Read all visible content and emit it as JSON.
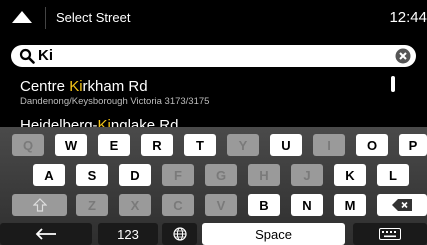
{
  "header": {
    "title": "Select Street",
    "time": "12:44"
  },
  "search": {
    "value": "Ki"
  },
  "results": [
    {
      "prefix": "Centre ",
      "match": "Ki",
      "suffix": "rkham Rd",
      "subtitle": "Dandenong/Keysborough Victoria 3173/3175"
    },
    {
      "prefix": "Heidelberg-",
      "match": "Ki",
      "suffix": "nglake Rd",
      "subtitle": ""
    }
  ],
  "keyboard": {
    "rows": [
      [
        {
          "label": "Q",
          "enabled": false
        },
        {
          "label": "W",
          "enabled": true
        },
        {
          "label": "E",
          "enabled": true
        },
        {
          "label": "R",
          "enabled": true
        },
        {
          "label": "T",
          "enabled": true
        },
        {
          "label": "Y",
          "enabled": false
        },
        {
          "label": "U",
          "enabled": true
        },
        {
          "label": "I",
          "enabled": false
        },
        {
          "label": "O",
          "enabled": true
        },
        {
          "label": "P",
          "enabled": true
        }
      ],
      [
        {
          "label": "A",
          "enabled": true
        },
        {
          "label": "S",
          "enabled": true
        },
        {
          "label": "D",
          "enabled": true
        },
        {
          "label": "F",
          "enabled": false
        },
        {
          "label": "G",
          "enabled": false
        },
        {
          "label": "H",
          "enabled": false
        },
        {
          "label": "J",
          "enabled": false
        },
        {
          "label": "K",
          "enabled": true
        },
        {
          "label": "L",
          "enabled": true
        }
      ],
      [
        {
          "label": "Z",
          "enabled": false
        },
        {
          "label": "X",
          "enabled": false
        },
        {
          "label": "C",
          "enabled": false
        },
        {
          "label": "V",
          "enabled": false
        },
        {
          "label": "B",
          "enabled": true
        },
        {
          "label": "N",
          "enabled": true
        },
        {
          "label": "M",
          "enabled": true
        }
      ]
    ],
    "shift_icon": "shift-arrow-icon",
    "backspace_icon": "backspace-icon",
    "back_icon": "arrow-left-icon",
    "numbers_label": "123",
    "globe_icon": "globe-icon",
    "space_label": "Space",
    "hide_keyboard_icon": "keyboard-icon"
  },
  "colors": {
    "highlight": "#f5c518",
    "disabled_key": "#9a9a9a",
    "background": "#000000"
  }
}
